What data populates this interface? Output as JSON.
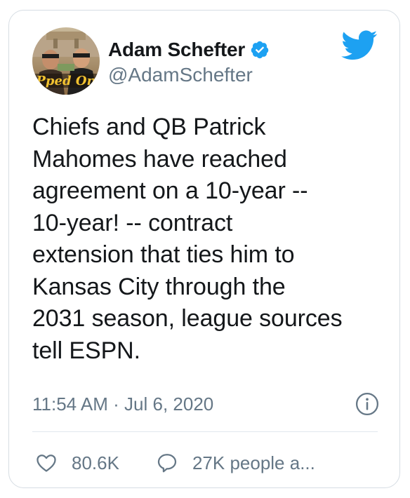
{
  "tweet": {
    "author": {
      "name": "Adam Schefter",
      "handle": "@AdamSchefter",
      "verified": true,
      "avatar_caption": "Pped On"
    },
    "text": "Chiefs and QB Patrick\nMahomes have reached\nagreement on a 10-year --\n10-year! -- contract\nextension that ties him to\nKansas City through the\n2031 season, league sources\ntell ESPN.",
    "timestamp": "11:54 AM · Jul 6, 2020",
    "likes": "80.6K",
    "replies_label": "27K people a..."
  },
  "icons": {
    "brand": "twitter-bird-icon",
    "verified": "verified-badge-icon",
    "info": "info-icon",
    "like": "heart-icon",
    "reply": "speech-bubble-icon"
  },
  "colors": {
    "twitter_blue": "#1da1f2",
    "text_primary": "#14171a",
    "text_secondary": "#657786",
    "border": "#d6dde3",
    "divider": "#e1e8ed"
  }
}
